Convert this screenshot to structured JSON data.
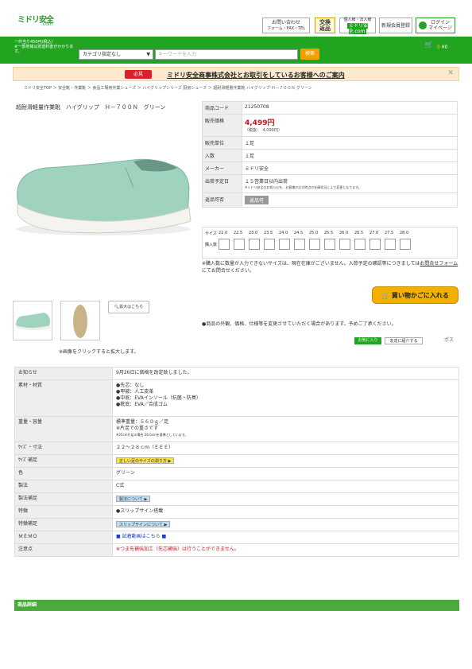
{
  "header": {
    "logo_main": "ミドリ安全",
    "logo_sub": ".com",
    "btn_contact": "お問い合わせ",
    "btn_contact_sub": "フォーム・FAX・TEL",
    "btn_return_top": "交換",
    "btn_return_bottom": "返品",
    "btn_member_title": "個人様・法人様",
    "btn_member_sub": "ミドリ安全.com",
    "btn_new_member": "新規会員登録",
    "btn_login": "ログイン",
    "btn_mypage": "マイページ"
  },
  "nav": {
    "promo_line1": "一件当り450円(税込)",
    "promo_line2": "※一部地域は別途料金がかかります。",
    "category_select": "カテゴリ指定なし",
    "search_placeholder": "キーワードを入力",
    "search_button": "検索",
    "cart_count": "0",
    "cart_amount": "¥0"
  },
  "notice": {
    "badge": "必見",
    "message": "ミドリ安全商事株式会社とお取引をしているお客様へのご案内"
  },
  "breadcrumb": "ミドリ安全TOP ＞ 安全靴・作業靴 ＞ 食品工場用作業シューズ ＞ ハイグリップシリーズ 厨房シューズ ＞ 超耐滑軽量作業靴 ハイグリップ Ｈ－７００Ｎ グリーン",
  "product": {
    "title": "超耐滑軽量作業靴　ハイグリップ　Ｈ－７００Ｎ　グリーン",
    "spec": [
      {
        "k": "商品コード",
        "v": "21250708"
      },
      {
        "k": "販売価格",
        "v": "4,499円",
        "sub": "（税抜：　4,090円）"
      },
      {
        "k": "販売単位",
        "v": "１足"
      },
      {
        "k": "入数",
        "v": "１足"
      },
      {
        "k": "メーカー",
        "v": "ミドリ安全"
      },
      {
        "k": "出荷予定日",
        "v": "１５営業日以内出荷",
        "sub": "※ミドリ安全のお知らせを、お客様の注文時点の在庫状況により変更となります。"
      },
      {
        "k": "返品可否",
        "v": "返品可"
      }
    ],
    "size_label": "サイズ",
    "qty_label": "購入数",
    "sizes": [
      "22.0",
      "22.5",
      "23.0",
      "23.5",
      "24.0",
      "24.5",
      "25.0",
      "25.5",
      "26.0",
      "26.5",
      "27.0",
      "27.5",
      "28.0"
    ],
    "note_pre": "※購入数に数量が入力できないサイズは、現在在庫がございません。入荷予定の確認等につきましては",
    "note_link": "お問合せフォーム",
    "note_post": "にてお問合せください。",
    "cart_button": "買い物かごに入れる",
    "zoom_button": "拡大はこちら",
    "caution": "●商品の外観、価格、仕様等を変更させていただく場合があります。予めご了承ください。",
    "share_favorite": "お気に入り",
    "share_mail": "友達に紹介する",
    "share_post": "ポス",
    "click_caption": "※画像をクリックすると拡大します。"
  },
  "info_rows": [
    {
      "k": "お知らせ",
      "v": "9月26日に価格を改定致しました。"
    },
    {
      "k": "素材・材質",
      "lines": [
        "●先芯：なし",
        "●甲被：人工皮革",
        "●中底：EVAインソール（抗菌・防臭）",
        "●靴底：EVA／合成ゴム"
      ]
    },
    {
      "k": "重量・容量",
      "lines": [
        "標準重量：５６０ｇ／足",
        "※片足での重さです"
      ],
      "sub": "※25cm片足の場合 26.0cmを基準としています。"
    },
    {
      "k": "ｻｲｽﾞ・寸法",
      "v": "２２～２８ｃｍ（ＥＥＥ）"
    },
    {
      "k": "ｻｲｽﾞ補足",
      "tag": "正しい足のサイズの測り方 ▶"
    },
    {
      "k": "色",
      "v": "グリーン"
    },
    {
      "k": "製法",
      "v": "C式"
    },
    {
      "k": "製法補足",
      "tag": "製法について ▶"
    },
    {
      "k": "特徴",
      "v": "●スリップサイン搭載"
    },
    {
      "k": "特徴補足",
      "tag": "スリップサインについて ▶"
    },
    {
      "k": "ＭＥＭＯ",
      "v": "■ 試着動画はこちら ■"
    },
    {
      "k": "注意点",
      "v": "※つま先補強加工（先芯補強）は行うことができません。"
    }
  ],
  "footer_section": "商品詳細",
  "colors": {
    "brand": "#21a521",
    "price": "#d0101b",
    "cart": "#f4b000"
  }
}
